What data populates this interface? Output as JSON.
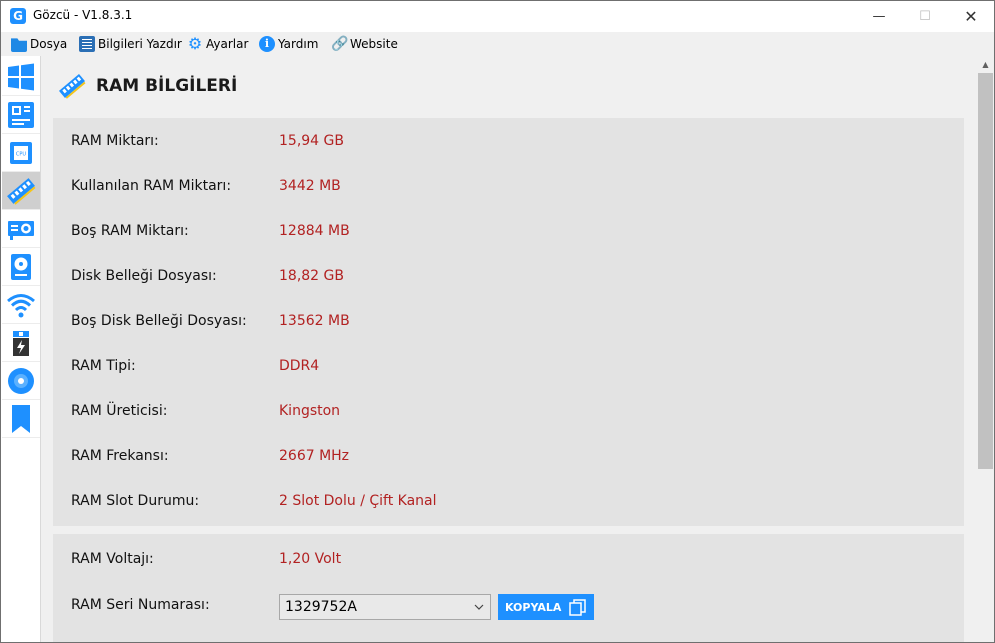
{
  "window": {
    "title": "Gözcü - V1.8.3.1",
    "app_icon_letter": "G",
    "controls": {
      "minimize": "—",
      "maximize": "☐",
      "close": "✕"
    }
  },
  "menu": [
    {
      "label": "Dosya",
      "icon": "folder-icon"
    },
    {
      "label": "Bilgileri Yazdır",
      "icon": "print-icon"
    },
    {
      "label": "Ayarlar",
      "icon": "gear-icon"
    },
    {
      "label": "Yardım",
      "icon": "info-icon"
    },
    {
      "label": "Website",
      "icon": "link-icon"
    }
  ],
  "sidebar": {
    "items": [
      {
        "icon": "windows-icon"
      },
      {
        "icon": "motherboard-icon"
      },
      {
        "icon": "cpu-icon"
      },
      {
        "icon": "ram-icon",
        "active": true
      },
      {
        "icon": "gpu-icon"
      },
      {
        "icon": "disk-icon"
      },
      {
        "icon": "wifi-icon"
      },
      {
        "icon": "battery-icon"
      },
      {
        "icon": "optical-disc-icon"
      },
      {
        "icon": "bookmark-icon"
      }
    ],
    "cpu_icon_text": "CPU"
  },
  "page": {
    "title": "RAM BİLGİLERİ"
  },
  "info_rows": [
    {
      "label": "RAM Miktarı:",
      "value": "15,94 GB"
    },
    {
      "label": "Kullanılan RAM Miktarı:",
      "value": "3442 MB"
    },
    {
      "label": "Boş RAM Miktarı:",
      "value": "12884 MB"
    },
    {
      "label": "Disk Belleği Dosyası:",
      "value": "18,82 GB"
    },
    {
      "label": "Boş Disk Belleği Dosyası:",
      "value": "13562 MB"
    },
    {
      "label": "RAM Tipi:",
      "value": "DDR4"
    },
    {
      "label": "RAM Üreticisi:",
      "value": "Kingston"
    },
    {
      "label": "RAM Frekansı:",
      "value": "2667 MHz"
    },
    {
      "label": "RAM Slot Durumu:",
      "value": "2 Slot Dolu / Çift Kanal"
    }
  ],
  "voltage": {
    "label": "RAM Voltajı:",
    "value": "1,20 Volt"
  },
  "serial": {
    "label": "RAM Seri Numarası:",
    "selected": "1329752A",
    "copy_label": "KOPYALA"
  },
  "colors": {
    "accent": "#1e90ff",
    "value_red": "#b22222",
    "panel_bg": "#e3e3e3"
  }
}
